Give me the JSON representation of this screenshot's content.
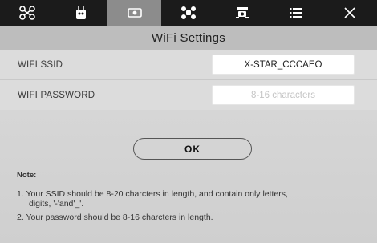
{
  "topbar": {
    "tabs": [
      {
        "icon": "drone-icon"
      },
      {
        "icon": "remote-controller-icon"
      },
      {
        "icon": "camera-icon",
        "active": true
      },
      {
        "icon": "drone-settings-icon"
      },
      {
        "icon": "gimbal-icon"
      },
      {
        "icon": "list-icon"
      },
      {
        "icon": "close-icon"
      }
    ]
  },
  "page": {
    "title": "WiFi Settings"
  },
  "ssid": {
    "label": "WIFI SSID",
    "value": "X-STAR_CCCAEO"
  },
  "password": {
    "label": "WIFI PASSWORD",
    "placeholder": "8-16 characters"
  },
  "ok_label": "OK",
  "notes": {
    "title": "Note:",
    "item1": "1. Your SSID should be 8-20 charcters in length, and contain only letters,",
    "item1b": "digits, '-'and'_'.",
    "item2": "2. Your password should be 8-16 charcters in length."
  },
  "colors": {
    "topbar": "#1b1b1b",
    "active_tab": "#8c8c8c",
    "title_bar": "#bdbdbd"
  }
}
